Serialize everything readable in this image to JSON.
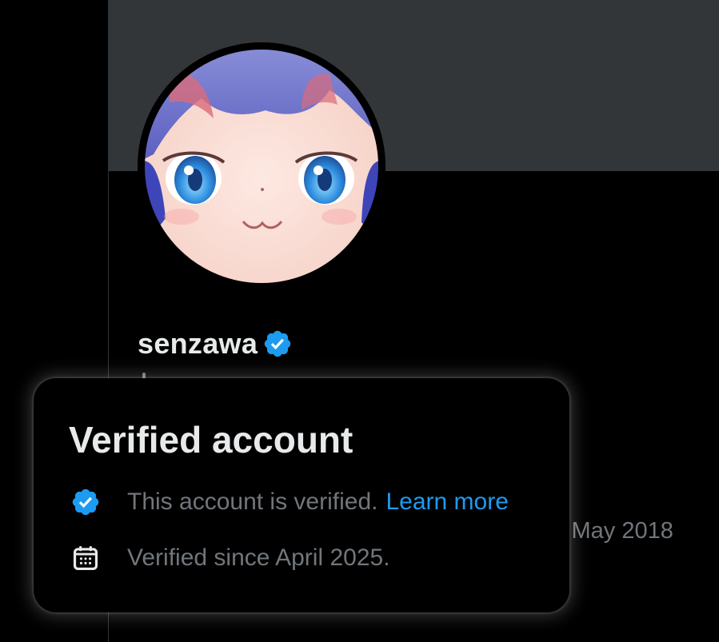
{
  "profile": {
    "display_name": "senzawa",
    "joined_fragment": "l May 2018"
  },
  "popover": {
    "title": "Verified account",
    "verified_text": "This account is verified.",
    "learn_more_label": "Learn more",
    "since_text": "Verified since April 2025."
  },
  "icons": {
    "verified": "verified-badge-icon",
    "calendar": "calendar-icon"
  },
  "colors": {
    "background": "#000000",
    "banner": "#333639",
    "primary_text": "#e7e9ea",
    "secondary_text": "#71767b",
    "accent": "#1d9bf0"
  }
}
